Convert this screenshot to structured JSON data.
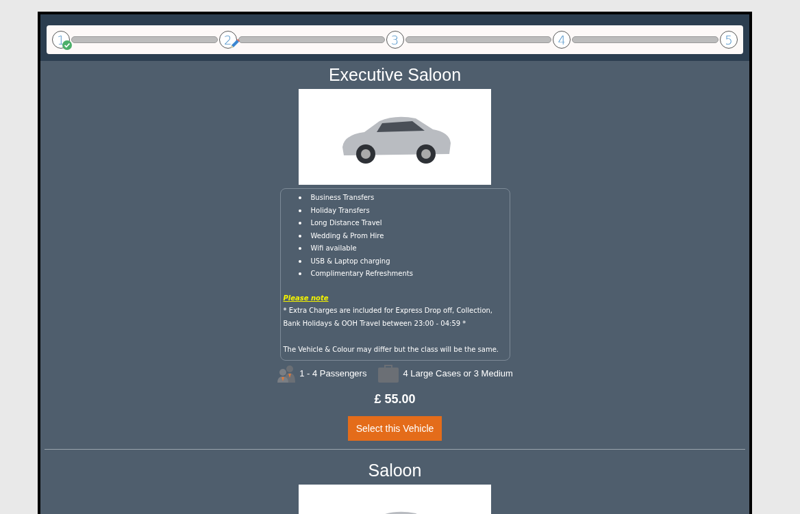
{
  "steps": [
    {
      "label": "1",
      "completed": true,
      "current": false
    },
    {
      "label": "2",
      "completed": false,
      "current": true
    },
    {
      "label": "3",
      "completed": false,
      "current": false
    },
    {
      "label": "4",
      "completed": false,
      "current": false
    },
    {
      "label": "5",
      "completed": false,
      "current": false
    }
  ],
  "vehicles": [
    {
      "title": "Executive Saloon",
      "features": [
        "Business Transfers",
        "Holiday Transfers",
        "Long Distance Travel",
        "Wedding & Prom Hire",
        "Wifi available",
        "USB & Laptop charging",
        "Complimentary Refreshments"
      ],
      "note_heading": "Please note",
      "note_lines": [
        "* Extra Charges are included for Express Drop off, Collection, Bank Holidays & OOH Travel between 23:00 - 04:59 *",
        "The Vehicle & Colour may differ but the class will be the same."
      ],
      "passengers": "1 - 4 Passengers",
      "luggage": "4 Large Cases or 3 Medium",
      "price": "£ 55.00",
      "button": "Select this Vehicle"
    },
    {
      "title": "Saloon"
    }
  ]
}
